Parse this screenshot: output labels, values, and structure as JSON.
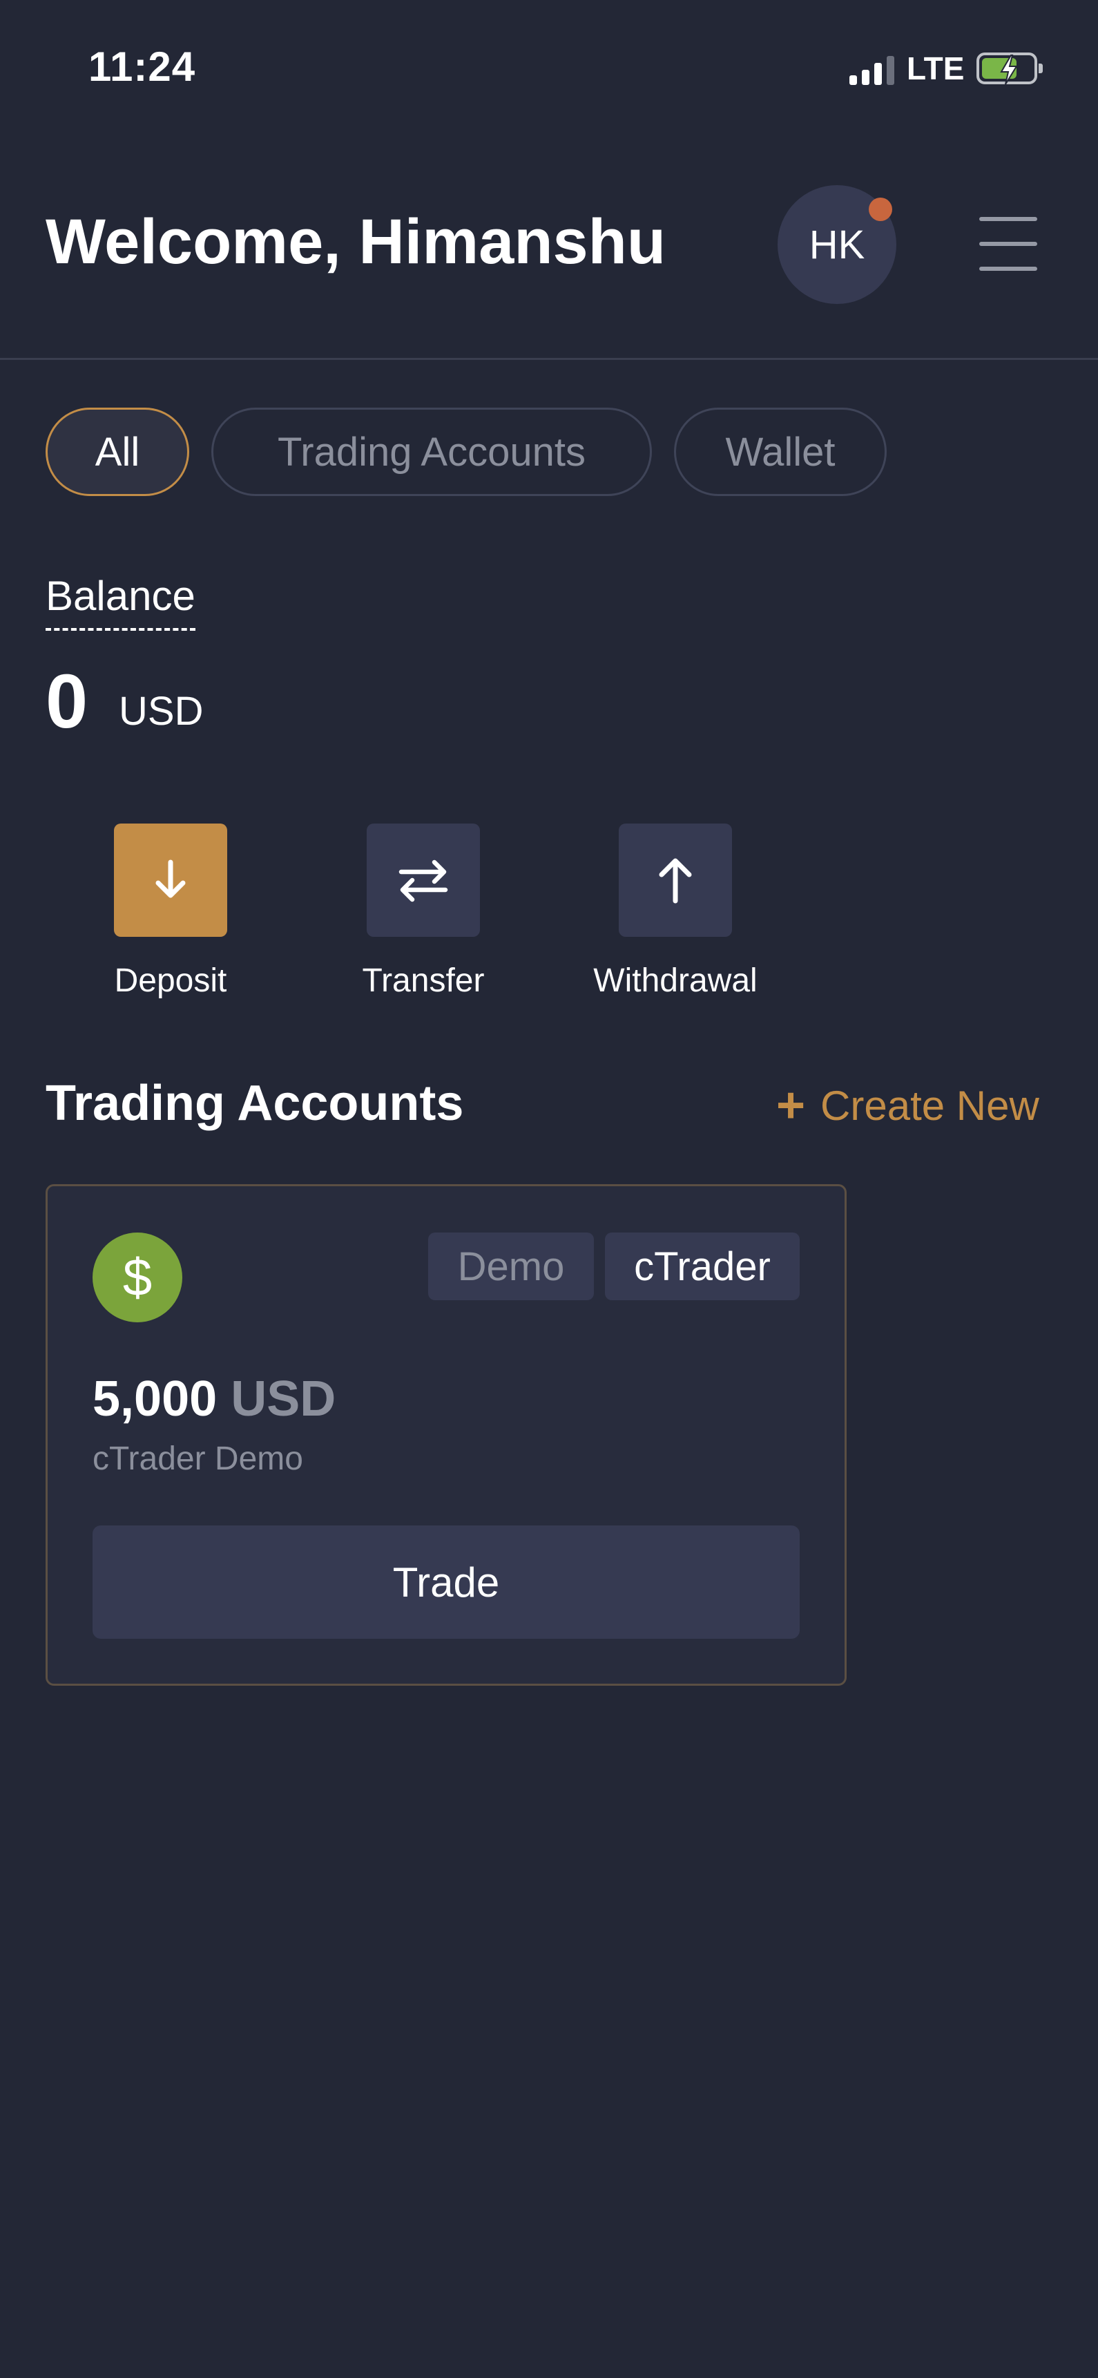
{
  "status_bar": {
    "time": "11:24",
    "network": "LTE",
    "battery_level": 0.62
  },
  "header": {
    "welcome": "Welcome, Himanshu",
    "avatar_initials": "HK",
    "menu_icon": "hamburger-menu-icon"
  },
  "filters": {
    "tabs": [
      "All",
      "Trading Accounts",
      "Wallet"
    ],
    "selected": "All"
  },
  "balance": {
    "label": "Balance",
    "value": "0",
    "currency": "USD"
  },
  "actions": [
    {
      "label": "Deposit",
      "icon": "arrow-down-icon"
    },
    {
      "label": "Transfer",
      "icon": "transfer-arrows-icon"
    },
    {
      "label": "Withdrawal",
      "icon": "arrow-up-icon"
    }
  ],
  "trading_accounts": {
    "title": "Trading Accounts",
    "create_new": "Create New",
    "accounts": [
      {
        "icon": "$",
        "badges": [
          "Demo",
          "cTrader"
        ],
        "balance": "5,000",
        "currency": "USD",
        "name": "cTrader Demo",
        "trade_label": "Trade"
      }
    ]
  },
  "colors": {
    "background": "#232736",
    "accent": "#c38d47",
    "coin": "#7ba43b",
    "card_bg": "#282c3d",
    "button_bg": "#363a52"
  }
}
